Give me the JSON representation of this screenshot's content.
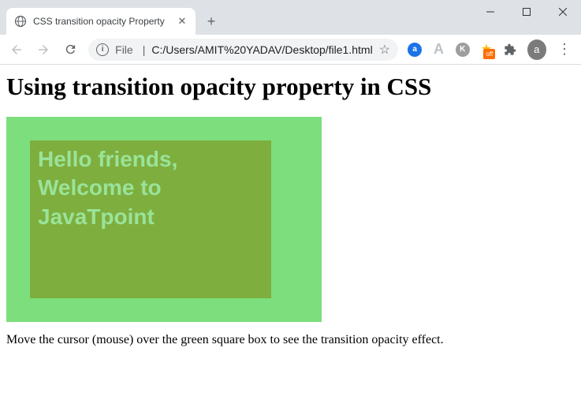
{
  "browser": {
    "tab_title": "CSS transition opacity Property",
    "url_prefix": "File",
    "url": "C:/Users/AMIT%20YADAV/Desktop/file1.html",
    "avatar_letter": "a",
    "ext_off_label": "off"
  },
  "page": {
    "heading": "Using transition opacity property in CSS",
    "line1": "Hello friends,",
    "line2": "Welcome to",
    "line3": "JavaTpoint",
    "instruction": "Move the cursor (mouse) over the green square box to see the transition opacity effect."
  }
}
